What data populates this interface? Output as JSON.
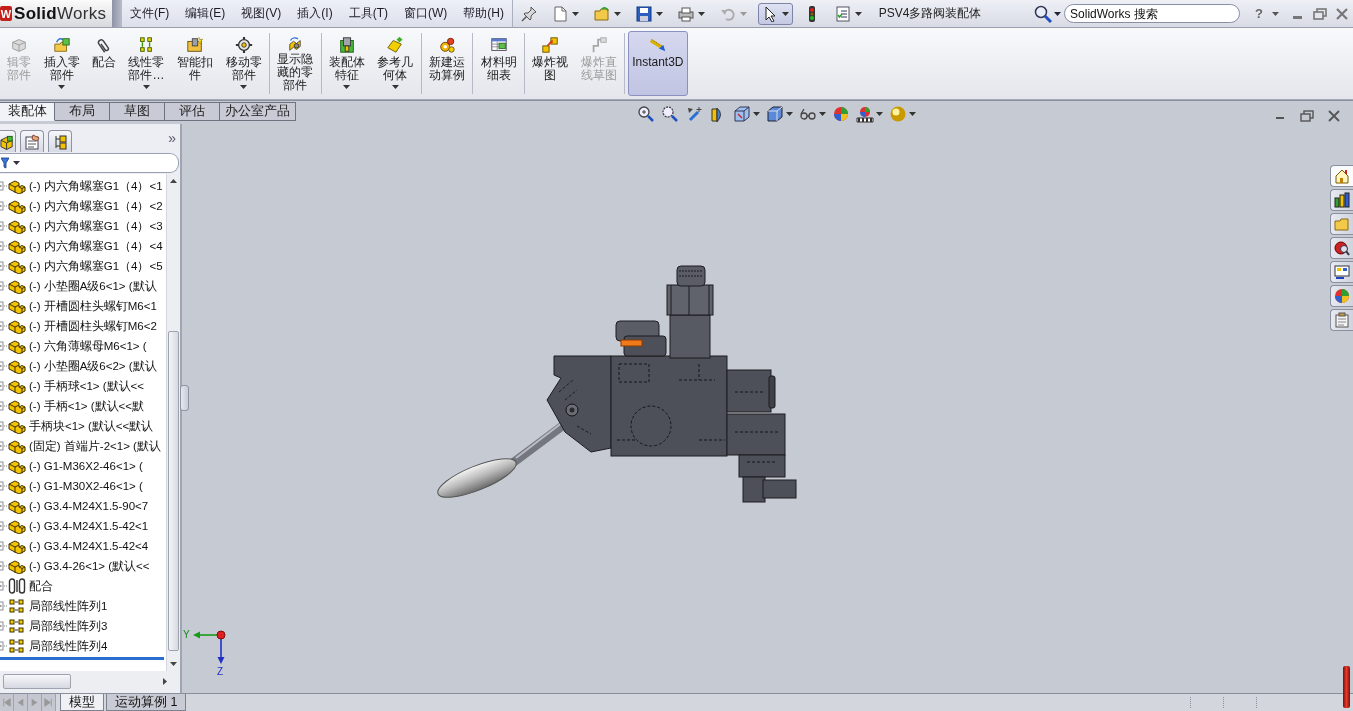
{
  "title_bar": {
    "logo_mark": "W",
    "logo": "**Solid**Works",
    "menus": [
      {
        "label": "文件(F)"
      },
      {
        "label": "编辑(E)"
      },
      {
        "label": "视图(V)"
      },
      {
        "label": "插入(I)"
      },
      {
        "label": "工具(T)"
      },
      {
        "label": "窗口(W)"
      },
      {
        "label": "帮助(H)"
      }
    ],
    "quick_access": [
      {
        "dropdown": false,
        "disabled": false,
        "selected": false
      },
      {
        "dropdown": true,
        "disabled": false,
        "selected": false
      },
      {
        "dropdown": true,
        "disabled": false,
        "selected": false
      },
      {
        "dropdown": true,
        "disabled": false,
        "selected": false
      },
      {
        "dropdown": true,
        "disabled": false,
        "selected": false
      },
      {
        "dropdown": true,
        "disabled": true,
        "selected": false
      },
      {
        "dropdown": true,
        "disabled": false,
        "selected": true
      },
      {
        "dropdown": false,
        "disabled": false,
        "selected": false
      },
      {
        "dropdown": true,
        "disabled": false,
        "selected": false
      }
    ],
    "document_title": "PSV4多路阀装配体",
    "search": {
      "placeholder": "SolidWorks 搜索"
    },
    "help": "?"
  },
  "command_manager": {
    "groups": [
      {
        "items": [
          {
            "label": "辑零部件",
            "disabled": true,
            "selected": false,
            "dropdown": false
          },
          {
            "label": "插入零部件",
            "disabled": false,
            "selected": false,
            "dropdown": true
          },
          {
            "label": "配合",
            "disabled": false,
            "selected": false,
            "dropdown": false
          },
          {
            "label": "线性零部件…",
            "disabled": false,
            "selected": false,
            "dropdown": true
          },
          {
            "label": "智能扣件",
            "disabled": false,
            "selected": false,
            "dropdown": false
          },
          {
            "label": "移动零部件",
            "disabled": false,
            "selected": false,
            "dropdown": true
          }
        ]
      },
      {
        "items": [
          {
            "label": "显示隐藏的零部件",
            "disabled": false,
            "selected": false,
            "dropdown": false
          }
        ]
      },
      {
        "items": [
          {
            "label": "装配体特征",
            "disabled": false,
            "selected": false,
            "dropdown": true
          },
          {
            "label": "参考几何体",
            "disabled": false,
            "selected": false,
            "dropdown": true
          }
        ]
      },
      {
        "items": [
          {
            "label": "新建运动算例",
            "disabled": false,
            "selected": false,
            "dropdown": false
          }
        ]
      },
      {
        "items": [
          {
            "label": "材料明细表",
            "disabled": false,
            "selected": false,
            "dropdown": false
          }
        ]
      },
      {
        "items": [
          {
            "label": "爆炸视图",
            "disabled": false,
            "selected": false,
            "dropdown": false
          },
          {
            "label": "爆炸直线草图",
            "disabled": true,
            "selected": false,
            "dropdown": false
          }
        ]
      },
      {
        "items": [
          {
            "label": "Instant3D",
            "disabled": false,
            "selected": true,
            "dropdown": false
          }
        ]
      }
    ]
  },
  "tabs": [
    {
      "label": "装配体",
      "selected": true
    },
    {
      "label": "布局",
      "selected": false
    },
    {
      "label": "草图",
      "selected": false
    },
    {
      "label": "评估",
      "selected": false
    },
    {
      "label": "办公室产品",
      "selected": false
    }
  ],
  "view_toolbar": [
    {
      "dropdown": false
    },
    {
      "dropdown": false
    },
    {
      "dropdown": false
    },
    {
      "dropdown": false
    },
    {
      "dropdown": true
    },
    {
      "dropdown": true
    },
    {
      "dropdown": true
    },
    {
      "dropdown": false
    },
    {
      "dropdown": true
    },
    {
      "dropdown": true
    }
  ],
  "feature_manager": {
    "more": "»",
    "rows": [
      {
        "kind": "part",
        "label": "(-) 内六角螺塞G1（4）<1"
      },
      {
        "kind": "part",
        "label": "(-) 内六角螺塞G1（4）<2"
      },
      {
        "kind": "part",
        "label": "(-) 内六角螺塞G1（4）<3"
      },
      {
        "kind": "part",
        "label": "(-) 内六角螺塞G1（4）<4"
      },
      {
        "kind": "part",
        "label": "(-) 内六角螺塞G1（4）<5"
      },
      {
        "kind": "part",
        "label": "(-) 小垫圈A级6<1> (默认"
      },
      {
        "kind": "part",
        "label": "(-) 开槽圆柱头螺钉M6<1"
      },
      {
        "kind": "part",
        "label": "(-) 开槽圆柱头螺钉M6<2"
      },
      {
        "kind": "part",
        "label": "(-) 六角薄螺母M6<1> ("
      },
      {
        "kind": "part",
        "label": "(-) 小垫圈A级6<2> (默认"
      },
      {
        "kind": "part",
        "label": "(-) 手柄球<1> (默认<<"
      },
      {
        "kind": "part",
        "label": "(-) 手柄<1> (默认<<默"
      },
      {
        "kind": "part",
        "label": "手柄块<1> (默认<<默认"
      },
      {
        "kind": "part",
        "label": "(固定) 首端片-2<1> (默认"
      },
      {
        "kind": "part",
        "label": "(-) G1-M36X2-46<1> ("
      },
      {
        "kind": "part",
        "label": "(-) G1-M30X2-46<1> ("
      },
      {
        "kind": "part",
        "label": "(-) G3.4-M24X1.5-90<7"
      },
      {
        "kind": "part",
        "label": "(-) G3.4-M24X1.5-42<1"
      },
      {
        "kind": "part",
        "label": "(-) G3.4-M24X1.5-42<4"
      },
      {
        "kind": "part",
        "label": "(-) G3.4-26<1> (默认<<"
      },
      {
        "kind": "mates",
        "label": "配合"
      },
      {
        "kind": "pattern",
        "label": "局部线性阵列1"
      },
      {
        "kind": "pattern",
        "label": "局部线性阵列3"
      },
      {
        "kind": "pattern",
        "label": "局部线性阵列4"
      }
    ]
  },
  "task_pane": [
    {
      "selected": true
    },
    {
      "selected": false
    },
    {
      "selected": false
    },
    {
      "selected": false
    },
    {
      "selected": false
    },
    {
      "selected": false
    },
    {
      "selected": false
    }
  ],
  "triad": {
    "y": "Y",
    "z": "Z"
  },
  "bottom_tabs": [
    {
      "label": "模型",
      "selected": true
    },
    {
      "label": "运动算例 1",
      "selected": false
    }
  ]
}
